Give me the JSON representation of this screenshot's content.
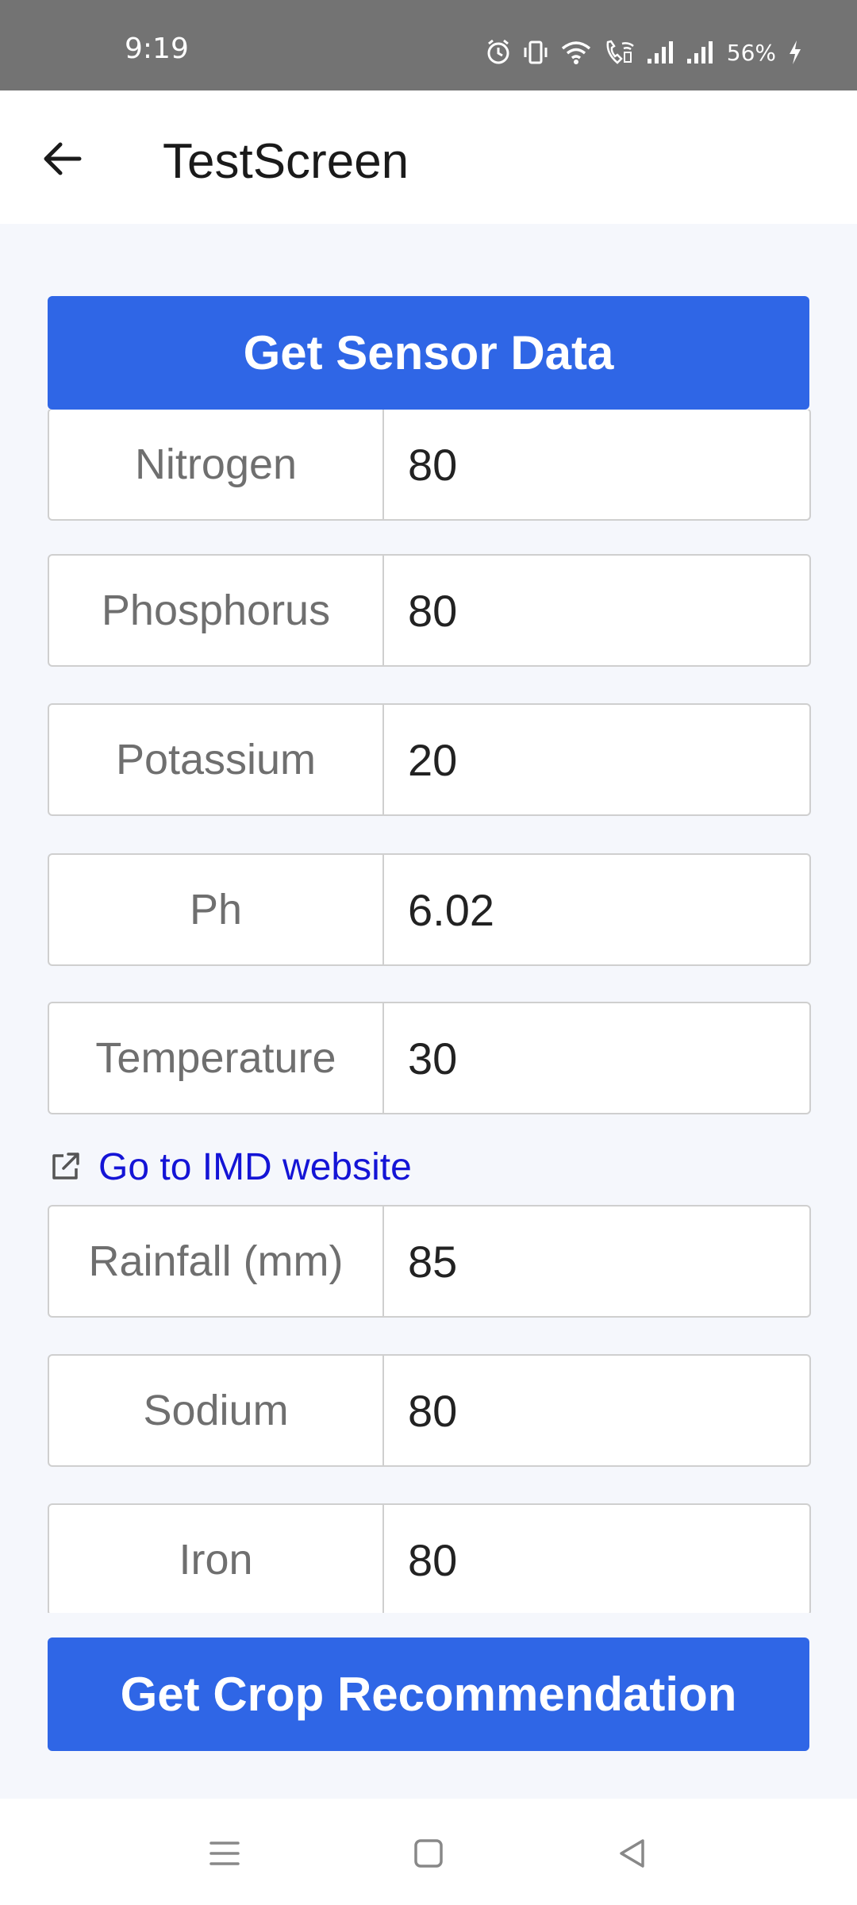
{
  "status_bar": {
    "time": "9:19",
    "battery": "56%"
  },
  "app_bar": {
    "title": "TestScreen"
  },
  "buttons": {
    "sensor": "Get Sensor Data",
    "recommend": "Get Crop Recommendation"
  },
  "fields": [
    {
      "label": "Nitrogen",
      "value": "80"
    },
    {
      "label": "Phosphorus",
      "value": "80"
    },
    {
      "label": "Potassium",
      "value": "20"
    },
    {
      "label": "Ph",
      "value": "6.02"
    },
    {
      "label": "Temperature",
      "value": "30"
    },
    {
      "label": "Rainfall (mm)",
      "value": "85"
    },
    {
      "label": "Sodium",
      "value": "80"
    },
    {
      "label": "Iron",
      "value": "80"
    }
  ],
  "imd_link": {
    "label": "Go to IMD website"
  },
  "colors": {
    "primary": "#2f66e6",
    "link": "#1414d6",
    "status_bar": "#737373",
    "background": "#f5f7fc"
  },
  "icons": {
    "back": "arrow-left-icon",
    "external_link": "external-link-icon",
    "nav_menu": "menu-icon",
    "nav_home": "square-icon",
    "nav_back": "triangle-back-icon"
  }
}
